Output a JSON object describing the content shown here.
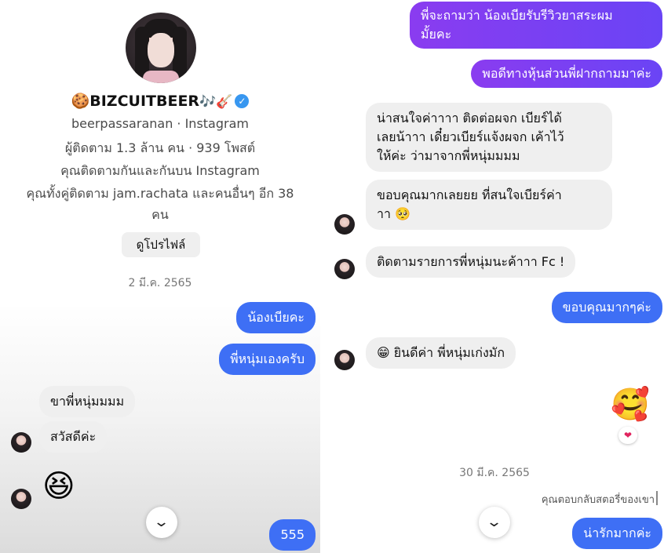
{
  "left": {
    "profile": {
      "display_name": "🍪BIZCUITBEER",
      "name_decor": "🎶🎸",
      "verified_glyph": "✓",
      "username_line": "beerpassaranan · Instagram",
      "stats_line": "ผู้ติดตาม 1.3 ล้าน คน · 939 โพสต์",
      "mutual_follow_line": "คุณติดตามกันและกันบน Instagram",
      "mutual_friends_line1": "คุณทั้งคู่ติดตาม jam.rachata และคนอื่นๆ อีก 38",
      "mutual_friends_line2": "คน",
      "view_profile_label": "ดูโปรไฟล์"
    },
    "date": "2 มี.ค. 2565",
    "messages": {
      "out1": "น้องเบียคะ",
      "out2": "พี่หนุ่มเองครับ",
      "in1": "ขาพี่หนุ่มมมม",
      "in2": "สวัสดีค่ะ",
      "in3_emoji": "😆",
      "out3": "555"
    },
    "scroll_glyph": "⌄"
  },
  "right": {
    "messages": {
      "out1_line1": "พี่จะถามว่า น้องเบียรับรีวิวยาสระผม",
      "out1_line2": "มั้ยคะ",
      "out2": "พอดีทางหุ้นส่วนพี่ฝากถามมาค่ะ",
      "in1_line1": "น่าสนใจค่าาาา ติดต่อผจก เบียร์ได้",
      "in1_line2": "เลยน้าาา เดี๋ยวเบียร์แจ้งผจก เค้าไว้",
      "in1_line3": "ให้ค่ะ ว่ามาจากพี่หนุ่มมมม",
      "in2_line1": "ขอบคุณมากเลยยย ที่สนใจเบียร์ค่า",
      "in2_line2": "าา 🥺",
      "in3": "ติดตามรายการพี่หนุ่มนะค้าาา Fc !",
      "out3": "ขอบคุณมากๆค่ะ",
      "in4": "😁 ยินดีค่า พี่หนุ่มเก่งมัก",
      "out4_emoji": "🥰",
      "reaction": "❤"
    },
    "date": "30 มี.ค. 2565",
    "story_reply_note": "คุณตอบกลับสตอรี่ของเขา",
    "out5": "น่ารักมากค่ะ",
    "scroll_glyph": "⌄"
  }
}
